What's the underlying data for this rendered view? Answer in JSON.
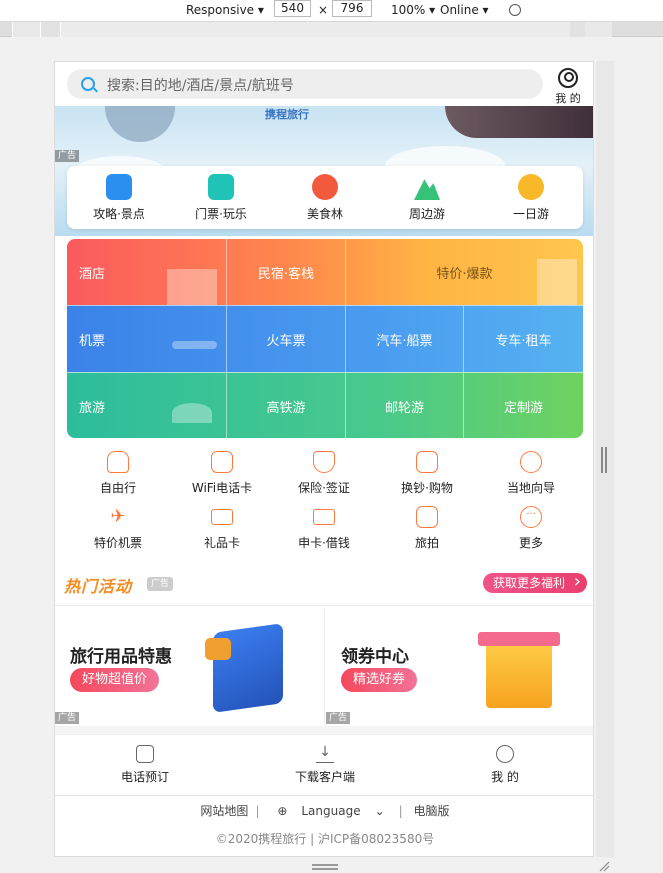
{
  "devtools": {
    "mode": "Responsive",
    "width": "540",
    "height": "796",
    "zoom": "100%",
    "network": "Online"
  },
  "header": {
    "search_placeholder": "搜索:目的地/酒店/景点/航班号",
    "me_label": "我 的"
  },
  "banner": {
    "logo_text": "携程旅行",
    "ad_label": "广告"
  },
  "quick_nav": [
    {
      "label": "攻略·景点",
      "icon": "guide-book-icon",
      "color": "#2b8ff0"
    },
    {
      "label": "门票·玩乐",
      "icon": "ticket-icon",
      "color": "#1fc4b6"
    },
    {
      "label": "美食林",
      "icon": "food-icon",
      "color": "#f2593d"
    },
    {
      "label": "周边游",
      "icon": "mountain-icon",
      "color": "#37c27a"
    },
    {
      "label": "一日游",
      "icon": "sun-icon",
      "color": "#f7b928"
    }
  ],
  "grid": {
    "row1": [
      "酒店",
      "民宿·客栈",
      "特价·爆款"
    ],
    "row2": [
      "机票",
      "火车票",
      "汽车·船票",
      "专车·租车"
    ],
    "row3": [
      "旅游",
      "高铁游",
      "邮轮游",
      "定制游"
    ]
  },
  "icon_list": [
    {
      "label": "自由行",
      "icon": "backpack-icon"
    },
    {
      "label": "WiFi电话卡",
      "icon": "wifi-card-icon"
    },
    {
      "label": "保险·签证",
      "icon": "shield-icon"
    },
    {
      "label": "换钞·购物",
      "icon": "shopping-bag-icon"
    },
    {
      "label": "当地向导",
      "icon": "hat-icon"
    },
    {
      "label": "特价机票",
      "icon": "plane-icon"
    },
    {
      "label": "礼品卡",
      "icon": "gift-card-icon"
    },
    {
      "label": "申卡·借钱",
      "icon": "credit-card-icon"
    },
    {
      "label": "旅拍",
      "icon": "camera-icon"
    },
    {
      "label": "更多",
      "icon": "more-icon"
    }
  ],
  "hot": {
    "title": "热门活动",
    "ad_label": "广告",
    "more_label": "获取更多福利"
  },
  "promos": [
    {
      "title": "旅行用品特惠",
      "button": "好物超值价",
      "ad_label": "广告"
    },
    {
      "title": "领券中心",
      "button": "精选好券",
      "ad_label": "广告"
    }
  ],
  "footer_nav": [
    {
      "label": "电话预订",
      "icon": "phone-icon"
    },
    {
      "label": "下载客户端",
      "icon": "download-icon"
    },
    {
      "label": "我 的",
      "icon": "user-icon"
    }
  ],
  "footer_links": {
    "sitemap": "网站地图",
    "language": "Language",
    "desktop": "电脑版"
  },
  "copyright": "©2020携程旅行 | 沪ICP备08023580号",
  "colors": {
    "accent_blue": "#2ba0e9",
    "orange": "#ff7a3d",
    "pink": "#e93f6d"
  }
}
